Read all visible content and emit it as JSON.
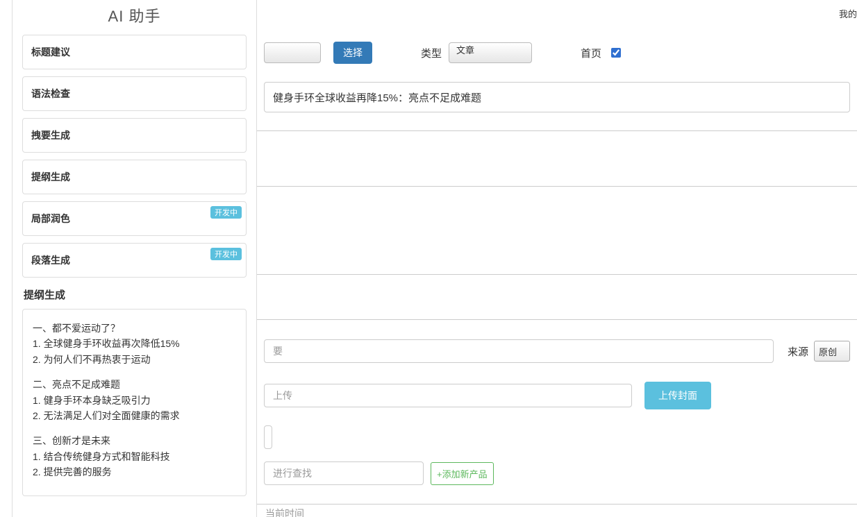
{
  "sidebar": {
    "title": "AI 助手",
    "items": [
      {
        "label": "标题建议",
        "badge": null
      },
      {
        "label": "语法检查",
        "badge": null
      },
      {
        "label": "拽要生成",
        "badge": null
      },
      {
        "label": "提纲生成",
        "badge": null
      },
      {
        "label": "局部润色",
        "badge": "开发中"
      },
      {
        "label": "段落生成",
        "badge": "开发中"
      }
    ],
    "result_header": "提纲生成",
    "outline": {
      "s1_title": "一、都不爱运动了？",
      "s1_1": "1. 全球健身手环收益再次降低15%",
      "s1_2": "2. 为何人们不再热衷于运动",
      "s2_title": "二、亮点不足成难题",
      "s2_1": "1. 健身手环本身缺乏吸引力",
      "s2_2": "2. 无法满足人们对全面健康的需求",
      "s3_title": "三、创新才是未来",
      "s3_1": "1. 结合传统健身方式和智能科技",
      "s3_2": "2. 提供完善的服务"
    }
  },
  "main": {
    "top_right": "我的",
    "select_button": "选择",
    "type_label": "类型",
    "type_value": "文章",
    "homepage_label": "首页",
    "homepage_checked": true,
    "title_value": "健身手环全球收益再降15%：亮点不足成难题",
    "row5_placeholder": "要",
    "source_label": "来源",
    "source_value": "原创",
    "row6_placeholder": "上传",
    "upload_button": "上传封面",
    "row8_placeholder": "进行查找",
    "add_product_button": "+添加新产品",
    "row10_placeholder": "当前时间"
  }
}
